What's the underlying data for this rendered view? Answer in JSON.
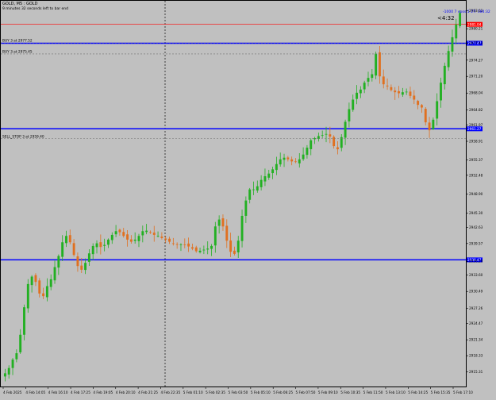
{
  "window": {
    "title": "GOLD, M5 : GOLD",
    "subtitle": "9 minutes 32 seconds left to bar end"
  },
  "colors": {
    "background": "#c0c0c0",
    "bull": "#22b022",
    "bear": "#e07020",
    "level_line": "#0000ff",
    "price_line": "#ff0000",
    "grid": "#808080"
  },
  "overlay": {
    "countdown": "<4:32",
    "label_text": "-1000 7 vpos:1 27: 184:32"
  },
  "orders": [
    {
      "label": "BUY 3 at 2977.52",
      "price": 2977.52
    },
    {
      "label": "BUY 3 at 2975.45",
      "price": 2975.45
    },
    {
      "label": "SELL_STOP 3 at 2959.40",
      "price": 2959.4
    }
  ],
  "hlines": [
    {
      "tag": "2977.47",
      "price": 2977.47,
      "style": "solid"
    },
    {
      "tag": "2961.27",
      "price": 2961.27,
      "style": "solid"
    },
    {
      "tag": "2936.47",
      "price": 2936.47,
      "style": "solid"
    },
    {
      "tag": "2981.04",
      "price": 2981.04,
      "style": "current"
    }
  ],
  "axis": {
    "y_min": 2912.5,
    "y_max": 2985.5,
    "x_labels": [
      "4 Feb 2025",
      "4 Feb 14:05",
      "4 Feb 16:10",
      "4 Feb 17:25",
      "4 Feb 19:05",
      "4 Feb 20:10",
      "4 Feb 21:25",
      "4 Feb 22:35",
      "5 Feb 01:10",
      "5 Feb 02:35",
      "5 Feb 03:50",
      "5 Feb 05:10",
      "5 Feb 06:25",
      "5 Feb 07:50",
      "5 Feb 09:10",
      "5 Feb 10:35",
      "5 Feb 11:50",
      "5 Feb 13:10",
      "5 Feb 14:25",
      "5 Feb 15:35",
      "5 Feb 17:10"
    ],
    "y_ticks": [
      "2983.63",
      "2980.21",
      "2977.43",
      "2974.27",
      "2971.20",
      "2968.04",
      "2964.82",
      "2961.97",
      "2958.91",
      "2955.37",
      "2952.48",
      "2948.90",
      "2945.30",
      "2942.63",
      "2939.57",
      "2936.20",
      "2933.60",
      "2930.49",
      "2927.26",
      "2924.47",
      "2921.34",
      "2918.33",
      "2915.31"
    ]
  },
  "chart_data": {
    "type": "candlestick",
    "symbol": "GOLD",
    "timeframe": "M5",
    "first_label": "4 Feb 2025",
    "last_label": "5 Feb 17:10",
    "ylim": [
      2912.5,
      2985.5
    ],
    "x_markers": [
      "4 Feb 2025",
      "4 Feb 14:05",
      "4 Feb 16:10",
      "4 Feb 17:25",
      "4 Feb 19:05",
      "4 Feb 20:10",
      "4 Feb 21:25",
      "4 Feb 22:35",
      "5 Feb 01:10",
      "5 Feb 02:35",
      "5 Feb 03:50",
      "5 Feb 05:10",
      "5 Feb 06:25",
      "5 Feb 07:50",
      "5 Feb 09:10",
      "5 Feb 10:35",
      "5 Feb 11:50",
      "5 Feb 13:10",
      "5 Feb 14:25",
      "5 Feb 15:35",
      "5 Feb 17:10"
    ],
    "close_path": [
      2915.0,
      2916.0,
      2917.6,
      2918.8,
      2922.3,
      2927.5,
      2931.9,
      2933.3,
      2932.3,
      2930.1,
      2929.6,
      2931.5,
      2932.8,
      2935.1,
      2937.2,
      2939.8,
      2941.0,
      2939.8,
      2937.4,
      2935.3,
      2934.6,
      2935.9,
      2937.7,
      2939.1,
      2939.6,
      2938.9,
      2939.3,
      2940.3,
      2941.2,
      2941.9,
      2941.7,
      2941.0,
      2940.3,
      2939.9,
      2940.3,
      2941.0,
      2941.9,
      2942.0,
      2941.6,
      2941.2,
      2941.0,
      2940.6,
      2940.3,
      2939.9,
      2939.5,
      2939.4,
      2939.4,
      2939.3,
      2939.0,
      2938.6,
      2938.1,
      2938.2,
      2938.4,
      2938.6,
      2939.1,
      2942.8,
      2944.1,
      2942.8,
      2940.1,
      2938.0,
      2937.6,
      2940.1,
      2944.8,
      2947.7,
      2949.8,
      2949.8,
      2950.4,
      2951.6,
      2952.3,
      2952.8,
      2953.6,
      2954.6,
      2955.5,
      2955.8,
      2955.5,
      2955.1,
      2955.0,
      2955.5,
      2956.4,
      2957.7,
      2959.1,
      2959.5,
      2959.9,
      2960.1,
      2960.3,
      2959.8,
      2958.0,
      2957.4,
      2959.7,
      2962.6,
      2965.0,
      2966.8,
      2968.1,
      2968.7,
      2970.0,
      2970.9,
      2971.6,
      2975.5,
      2971.2,
      2969.7,
      2969.3,
      2968.6,
      2968.2,
      2968.0,
      2968.2,
      2968.3,
      2967.5,
      2966.8,
      2965.8,
      2965.3,
      2962.5,
      2961.0,
      2963.0,
      2966.5,
      2970.0,
      2973.2,
      2976.0,
      2978.6,
      2981.0,
      2983.2
    ]
  }
}
